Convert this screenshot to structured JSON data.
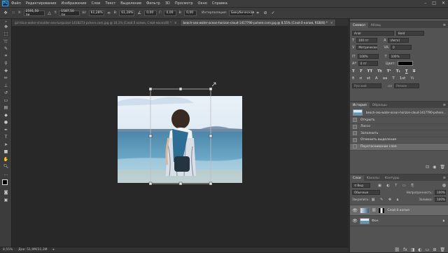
{
  "menubar": {
    "logo": "Ps",
    "items": [
      "Файл",
      "Редактирование",
      "Изображение",
      "Слои",
      "Текст",
      "Выделение",
      "Фильтр",
      "3D",
      "Просмотр",
      "Окно",
      "Справка"
    ]
  },
  "options": {
    "x_label": "X:",
    "x_value": "2591,50 пи",
    "y_label": "Y:",
    "y_value": "1587,50 пи",
    "w_label": "Ш:",
    "w_value": "61,28%",
    "h_label": "В:",
    "h_value": "61,28%",
    "angle_value": "0,00",
    "hskew_label": "Г:",
    "hskew_value": "0,00",
    "vskew_label": "В:",
    "vskew_value": "0,00",
    "interp_label": "Интерполяция:",
    "interp_value": "Бикубическая"
  },
  "tabs": [
    {
      "label": "girl-blue-water-shoulder-sea-turquoise-1418273-pxhere.com.jpg @ 16,1% (Слой 0 копия, Слой-маска/8) *",
      "active": false
    },
    {
      "label": "beach-sea-water-ocean-horizon-cloud-1417790-pxhere.com.jpg @ 8,55% (Слой 0 копия, RGB/8) *",
      "active": true
    }
  ],
  "status": {
    "zoom": "8,55%",
    "doc": "Док: 51,9M/31,3M"
  },
  "character": {
    "tabs": [
      "Символ",
      "Абзац"
    ],
    "font": "Arial",
    "style": "Bold",
    "size": "100 пт",
    "leading": "(Авто)",
    "kerning": "Метрически",
    "tracking": "0",
    "vscale": "100%",
    "hscale": "100%",
    "baseline": "0 пт",
    "color_label": "Цвет:",
    "color": "#000000",
    "lang": "Русский",
    "aa": "Резкое"
  },
  "history": {
    "tabs": [
      "История",
      "Образцы"
    ],
    "snapshot": "beach-sea-water-ocean-horizon-cloud-1417790-pxhere...",
    "items": [
      "Открыть",
      "Лассо",
      "Заполнить",
      "Отменить выделение",
      "Перетаскивание слоя"
    ]
  },
  "layers": {
    "tabs": [
      "Слои",
      "Каналы",
      "Контуры"
    ],
    "filter": "Вид",
    "blend": "Обычные",
    "opacity_label": "Непрозрачность:",
    "opacity": "100%",
    "lock_label": "Закрепить:",
    "fill_label": "Заливка:",
    "fill": "100%",
    "items": [
      {
        "name": "Слой 0 копия",
        "selected": true
      },
      {
        "name": "Фон",
        "selected": false
      }
    ]
  },
  "colors": {
    "accent": "#31a8ff",
    "bg": "#282828",
    "panel": "#535353"
  }
}
